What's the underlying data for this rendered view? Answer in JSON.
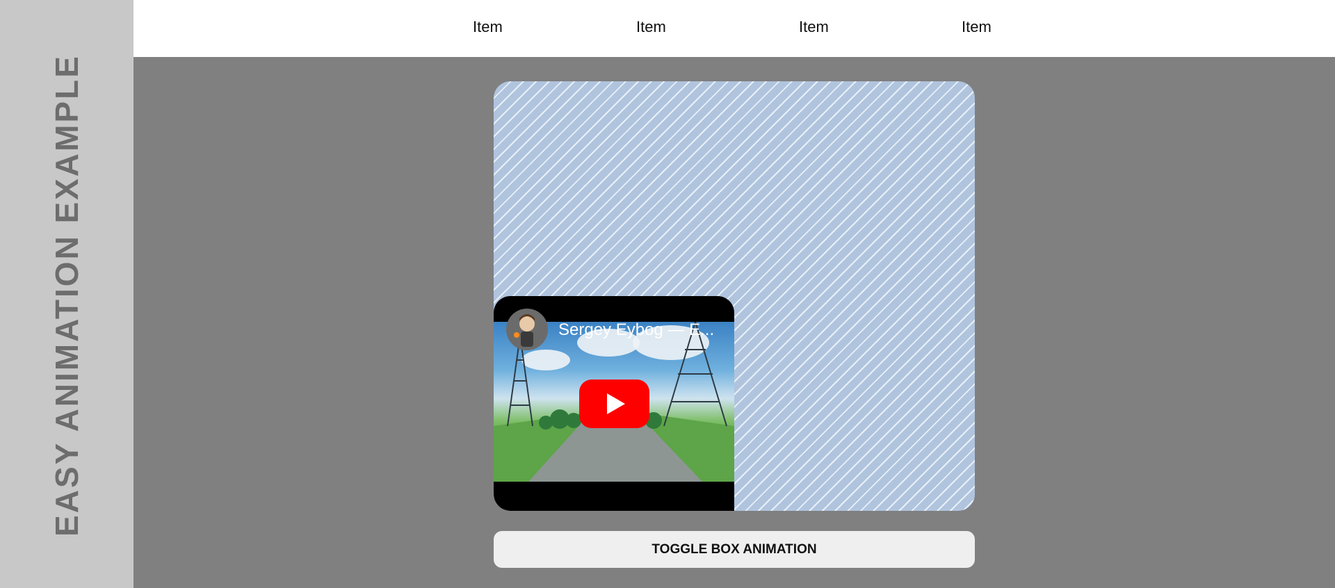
{
  "sidebar": {
    "title": "EASY ANIMATION EXAMPLE"
  },
  "nav": {
    "items": [
      "Item",
      "Item",
      "Item",
      "Item"
    ]
  },
  "video": {
    "title": "Sergey Eybog — E...",
    "icons": {
      "play": "youtube-play-icon",
      "avatar": "channel-avatar"
    }
  },
  "controls": {
    "toggle_label": "TOGGLE BOX ANIMATION"
  },
  "colors": {
    "page_bg": "#808080",
    "sidebar_bg": "#c8c8c8",
    "box_bg": "#b0c4de",
    "stripe": "#e8f0f8",
    "play_red": "#ff0000",
    "button_bg": "#efefef"
  }
}
